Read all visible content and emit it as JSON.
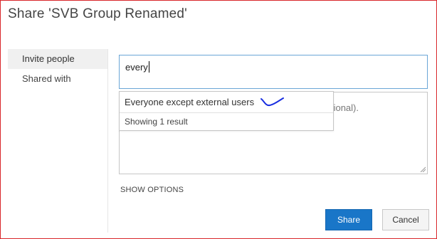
{
  "dialog": {
    "title": "Share 'SVB Group Renamed'"
  },
  "nav": {
    "items": [
      {
        "label": "Invite people",
        "active": true
      },
      {
        "label": "Shared with",
        "active": false
      }
    ]
  },
  "invite": {
    "value": "every"
  },
  "message": {
    "placeholder_visible_fragment": "ional)."
  },
  "suggestions": {
    "items": [
      "Everyone except external users"
    ],
    "status": "Showing 1 result"
  },
  "options": {
    "show_options_label": "SHOW OPTIONS"
  },
  "actions": {
    "share_label": "Share",
    "cancel_label": "Cancel"
  },
  "colors": {
    "frame_border": "#d9262a",
    "primary_button": "#1976c8",
    "input_focus_border": "#6aa6d6",
    "ink_mark": "#1a2fe0"
  }
}
